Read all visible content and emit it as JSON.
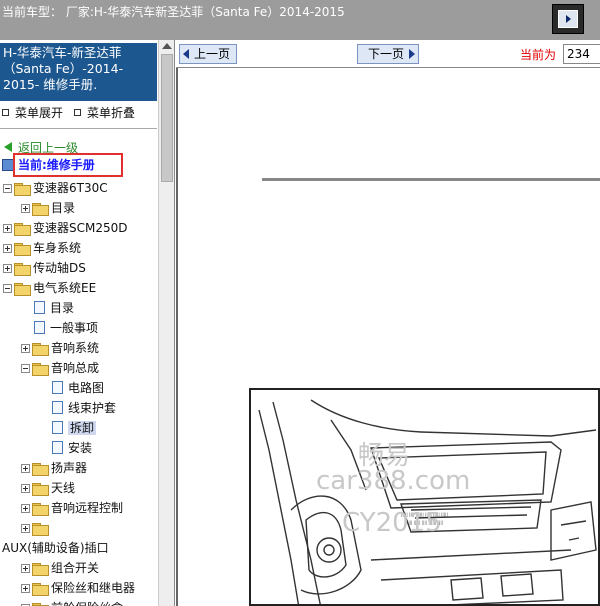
{
  "topbar": {
    "title": "当前车型：  厂家:H-华泰汽车新圣达菲（Santa Fe）2014-2015"
  },
  "sidebar": {
    "header": "H-华泰汽车-新圣达菲（Santa Fe）-2014-2015- 维修手册.",
    "expand_label": "菜单展开",
    "collapse_label": "菜单折叠",
    "back_label": "返回上一级",
    "current_label": "当前:维修手册",
    "tree": [
      {
        "label": "变速器6T30C",
        "indent": 0,
        "kind": "folder",
        "pm": "minus"
      },
      {
        "label": "目录",
        "indent": 1,
        "kind": "folder",
        "pm": "plus"
      },
      {
        "label": "变速器SCM250D",
        "indent": 0,
        "kind": "folder",
        "pm": "plus"
      },
      {
        "label": "车身系统",
        "indent": 0,
        "kind": "folder",
        "pm": "plus"
      },
      {
        "label": "传动轴DS",
        "indent": 0,
        "kind": "folder",
        "pm": "plus"
      },
      {
        "label": "电气系统EE",
        "indent": 0,
        "kind": "folder",
        "pm": "minus"
      },
      {
        "label": "目录",
        "indent": 1,
        "kind": "doc"
      },
      {
        "label": "一般事项",
        "indent": 1,
        "kind": "doc"
      },
      {
        "label": "音响系统",
        "indent": 1,
        "kind": "folder",
        "pm": "plus"
      },
      {
        "label": "音响总成",
        "indent": 1,
        "kind": "folder",
        "pm": "minus"
      },
      {
        "label": "电路图",
        "indent": 2,
        "kind": "doc"
      },
      {
        "label": "线束护套",
        "indent": 2,
        "kind": "doc"
      },
      {
        "label": "拆卸",
        "indent": 2,
        "kind": "doc",
        "selected": true
      },
      {
        "label": "安装",
        "indent": 2,
        "kind": "doc"
      },
      {
        "label": "扬声器",
        "indent": 1,
        "kind": "folder",
        "pm": "plus"
      },
      {
        "label": "天线",
        "indent": 1,
        "kind": "folder",
        "pm": "plus"
      },
      {
        "label": "音响远程控制",
        "indent": 1,
        "kind": "folder",
        "pm": "plus"
      },
      {
        "label": "",
        "indent": 1,
        "kind": "folder",
        "pm": "plus"
      },
      {
        "label": "AUX(辅助设备)插口",
        "indent": -1,
        "kind": "text"
      },
      {
        "label": "组合开关",
        "indent": 1,
        "kind": "folder",
        "pm": "plus"
      },
      {
        "label": "保险丝和继电器",
        "indent": 1,
        "kind": "folder",
        "pm": "plus"
      },
      {
        "label": "前舱保险丝盒",
        "indent": 1,
        "kind": "folder",
        "pm": "plus"
      }
    ]
  },
  "nav": {
    "prev_label": "上一页",
    "next_label": "下一页",
    "page_label": "当前为",
    "page_value": "234"
  },
  "watermark": {
    "line1": "畅易",
    "line2": "car388.com",
    "line3": "CY2015"
  },
  "colors": {
    "topbar_bg": "#9c9c9c",
    "sidebar_header_bg": "#1c5790",
    "highlight_border": "#e03030",
    "page_label": "#e00000"
  }
}
